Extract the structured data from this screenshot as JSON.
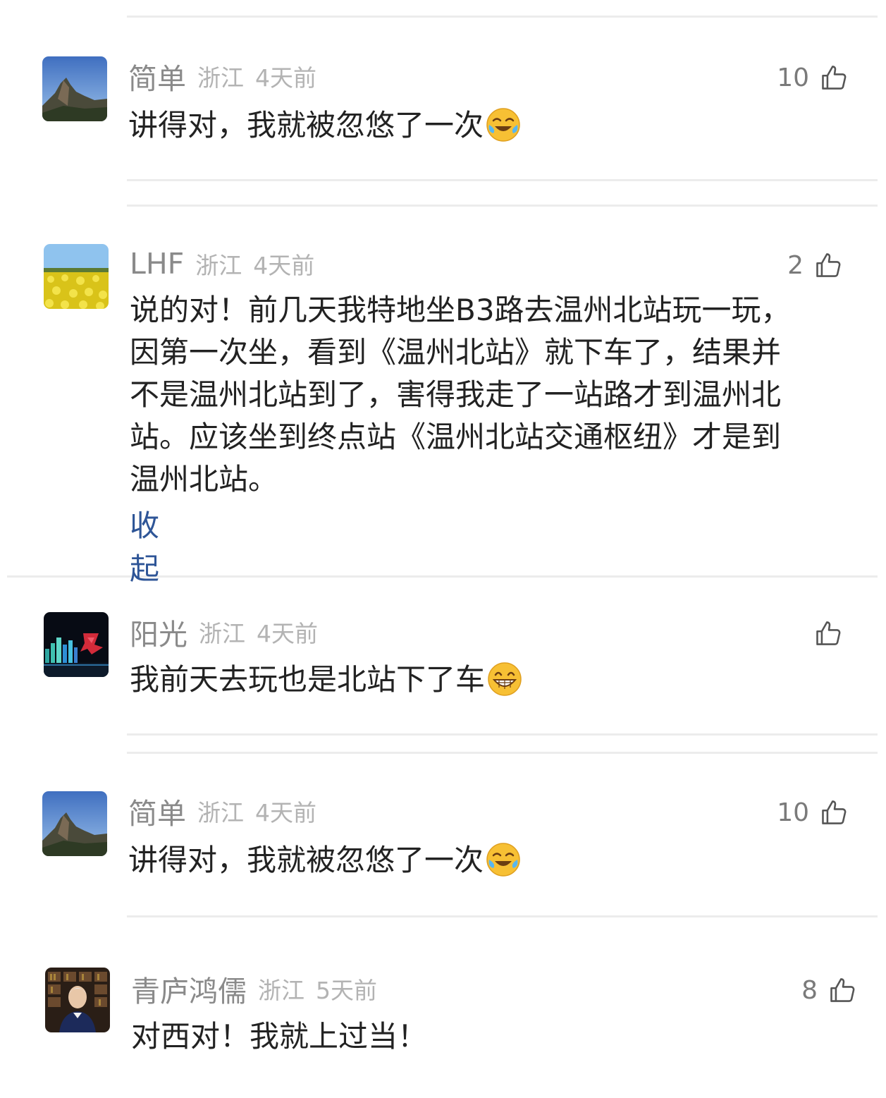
{
  "comments": [
    {
      "username": "简单",
      "region": "浙江",
      "time": "4天前",
      "likes": "10",
      "text": "讲得对，我就被忽悠了一次",
      "emoji": "laugh-cry-emoji"
    },
    {
      "username": "LHF",
      "region": "浙江",
      "time": "4天前",
      "likes": "2",
      "lines": [
        "说的对！前几天我特地坐B3路去温州北站玩一玩，",
        "因第一次坐，看到《温州北站》就下车了，结果并",
        "不是温州北站到了，害得我走了一站路才到温州北",
        "站。应该坐到终点站《温州北站交通枢纽》才是到",
        "温州北站。"
      ],
      "collapse_label": "收起"
    },
    {
      "username": "阳光",
      "region": "浙江",
      "time": "4天前",
      "likes": "",
      "text": "我前天去玩也是北站下了车",
      "emoji": "grin-emoji"
    },
    {
      "username": "简单",
      "region": "浙江",
      "time": "4天前",
      "likes": "10",
      "text": "讲得对，我就被忽悠了一次",
      "emoji": "laugh-cry-emoji"
    },
    {
      "username": "青庐鸿儒",
      "region": "浙江",
      "time": "5天前",
      "likes": "8",
      "text": "对西对！我就上过当！"
    }
  ],
  "icons": {
    "like": "thumbs-up-icon"
  },
  "colors": {
    "link": "#2e5597",
    "meta": "#b3b3b3",
    "username": "#8a8a8a",
    "separator": "#ececec"
  }
}
